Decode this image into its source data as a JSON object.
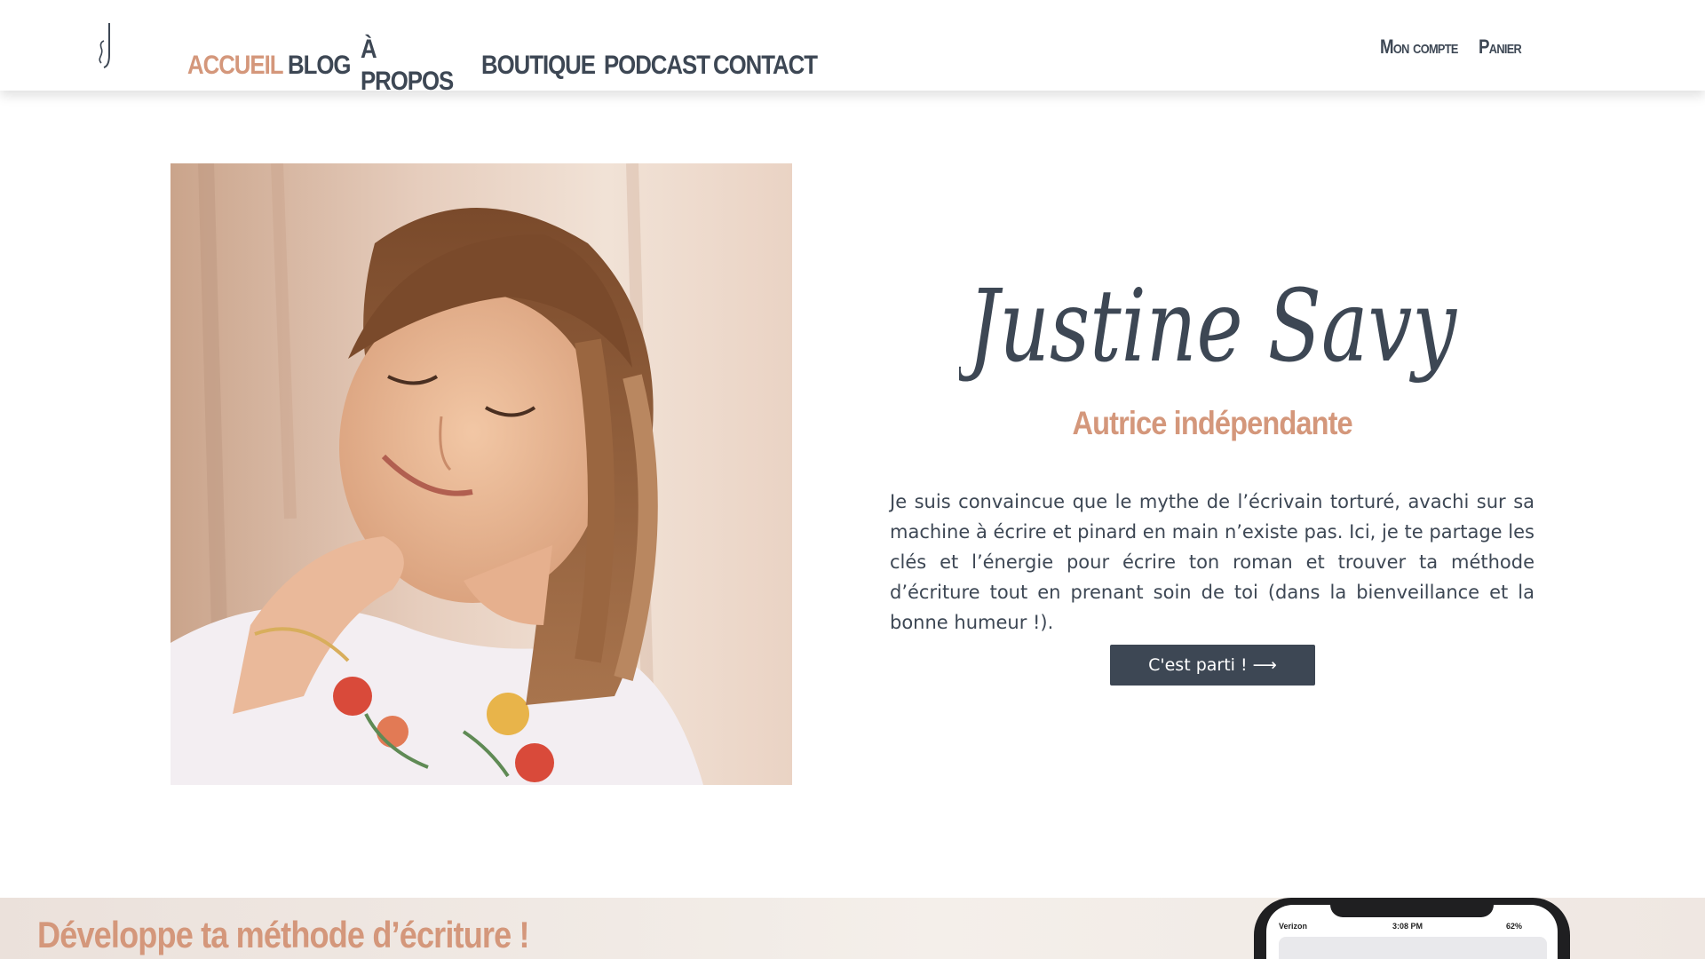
{
  "header": {
    "logo_icon": "sj-monogram-icon",
    "nav": [
      {
        "label": "ACCUEIL",
        "active": true
      },
      {
        "label": "BLOG",
        "active": false
      },
      {
        "label": "À PROPOS",
        "active": false
      },
      {
        "label": "BOUTIQUE",
        "active": false
      },
      {
        "label": "PODCAST",
        "active": false
      },
      {
        "label": "CONTACT",
        "active": false
      }
    ],
    "account": {
      "my_account": "Mon compte",
      "cart": "Panier"
    }
  },
  "hero": {
    "photo": "portrait-photo",
    "signature_name": "Justine Savy",
    "subtitle": "Autrice indépendante",
    "intro": "Je suis convaincue que le mythe de l’écrivain torturé, avachi sur sa machine à écrire et pinard en main n’existe pas. Ici, je te partage les clés et l’énergie pour écrire ton roman et trouver ta méthode d’écriture tout en prenant soin de toi (dans la bienveillance et la bonne humeur !).",
    "cta_label": "C'est parti ! ⟶"
  },
  "method_section": {
    "title": "Développe ta méthode d’écriture !",
    "phone": {
      "carrier": "Verizon",
      "time": "3:08 PM",
      "battery": "62%"
    }
  },
  "colors": {
    "accent": "#d4977b",
    "text": "#3d4754",
    "button_bg": "#3d4754"
  }
}
